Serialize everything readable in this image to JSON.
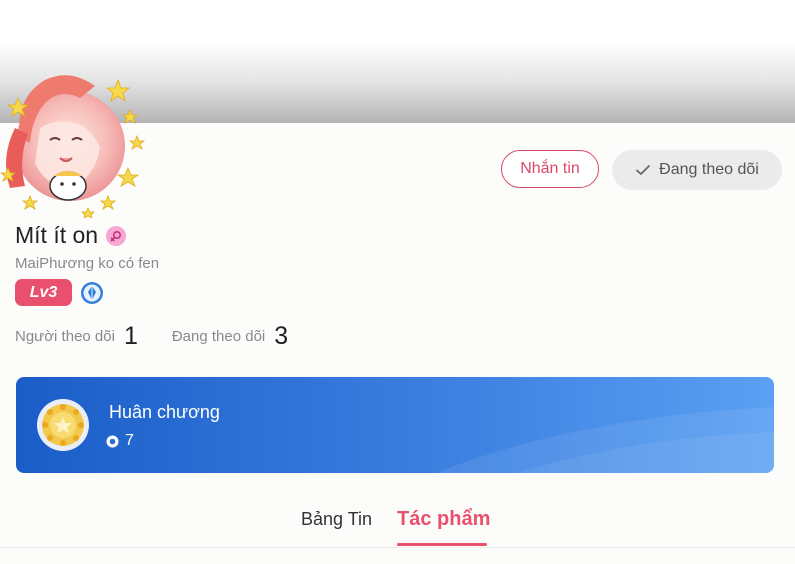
{
  "profile": {
    "name": "Mít ít on",
    "bio": "MaiPhương ko có fen",
    "level": "Lv3"
  },
  "actions": {
    "message_label": "Nhắn tin",
    "following_label": "Đang theo dõi"
  },
  "stats": {
    "followers_label": "Người theo dõi",
    "followers_value": "1",
    "following_label": "Đang theo dõi",
    "following_value": "3"
  },
  "medal": {
    "title": "Huân chương",
    "count": "7"
  },
  "tabs": [
    {
      "label": "Bảng Tin",
      "active": false
    },
    {
      "label": "Tác phẩm",
      "active": true
    }
  ],
  "colors": {
    "accent": "#e8506d",
    "medal_card": "#2a6fd6",
    "following_button": "#ebebeb"
  },
  "icons": {
    "gender": "female-symbol-icon",
    "vip": "blue-gem-icon",
    "check": "check-icon",
    "medal": "gold-medal-icon",
    "medal_count": "small-circle-icon"
  }
}
